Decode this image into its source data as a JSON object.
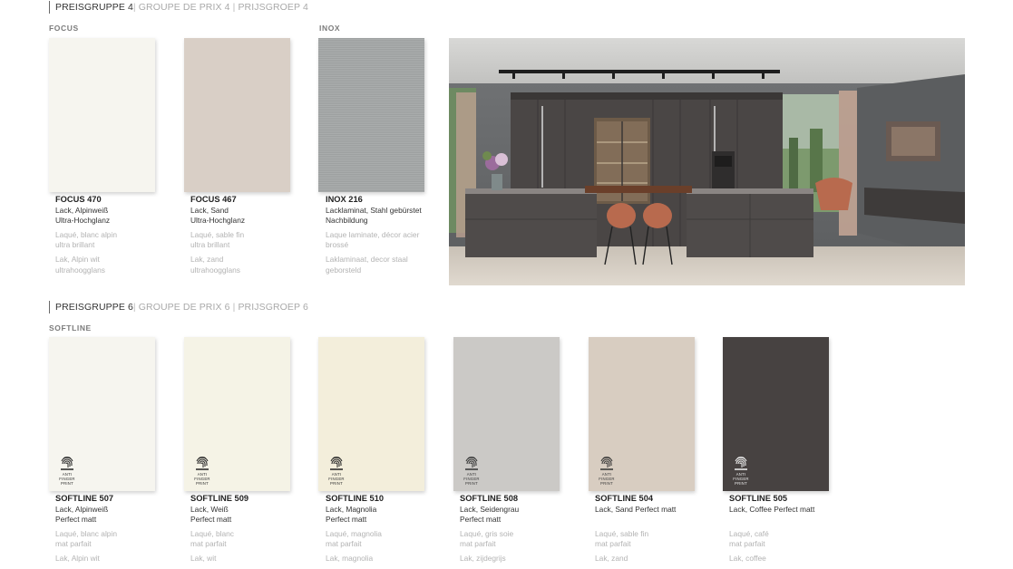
{
  "groups": [
    {
      "title_main": "PREISGRUPPE 4",
      "title_fr": "GROUPE DE PRIX 4",
      "title_nl": "PRIJSGROEP 4"
    },
    {
      "title_main": "PREISGRUPPE 6",
      "title_fr": "GROUPE DE PRIX 6",
      "title_nl": "PRIJSGROEP 6"
    }
  ],
  "lines": {
    "focus": "FOCUS",
    "inox": "INOX",
    "softline": "SOFTLINE"
  },
  "colors": {
    "focus_470": "#f6f5ef",
    "focus_467": "#d9cfc6",
    "inox_216": "#a3a6a6",
    "softline_507": "#f6f5ef",
    "softline_509": "#f5f3e6",
    "softline_510": "#f3eedb",
    "softline_508": "#cbc9c6",
    "softline_504": "#d8cdc1",
    "softline_505": "#474241"
  },
  "anti_fingerprint": {
    "line1": "ANTI",
    "line2": "FINGER",
    "line3": "PRINT",
    "icon": "fingerprint-icon"
  },
  "products": [
    {
      "name": "FOCUS 470",
      "de1": "Lack, Alpinweiß",
      "de2": "Ultra-Hochglanz",
      "fr1": "Laqué, blanc alpin",
      "fr2": "ultra brillant",
      "nl1": "Lak, Alpin wit",
      "nl2": "ultrahoogglans"
    },
    {
      "name": "FOCUS 467",
      "de1": "Lack, Sand",
      "de2": "Ultra-Hochglanz",
      "fr1": "Laqué, sable fin",
      "fr2": "ultra brillant",
      "nl1": "Lak, zand",
      "nl2": "ultrahoogglans"
    },
    {
      "name": "INOX 216",
      "de1": "Lacklaminat, Stahl gebürstet",
      "de2": "Nachbildung",
      "fr1": "Laque laminate, décor acier",
      "fr2": "brossé",
      "nl1": "Laklaminaat, decor staal",
      "nl2": "geborsteld"
    },
    {
      "name": "SOFTLINE 507",
      "de1": "Lack, Alpinweiß",
      "de2": "Perfect matt",
      "fr1": "Laqué, blanc alpin",
      "fr2": "mat parfait",
      "nl1": "Lak, Alpin wit"
    },
    {
      "name": "SOFTLINE 509",
      "de1": "Lack, Weiß",
      "de2": "Perfect matt",
      "fr1": "Laqué, blanc",
      "fr2": "mat parfait",
      "nl1": "Lak, wit"
    },
    {
      "name": "SOFTLINE 510",
      "de1": "Lack, Magnolia",
      "de2": "Perfect matt",
      "fr1": "Laqué, magnolia",
      "fr2": "mat parfait",
      "nl1": "Lak, magnolia"
    },
    {
      "name": "SOFTLINE 508",
      "de1": "Lack, Seidengrau",
      "de2": "Perfect matt",
      "fr1": "Laqué, gris soie",
      "fr2": "mat parfait",
      "nl1": "Lak, zijdegrijs"
    },
    {
      "name": "SOFTLINE 504",
      "de1": "Lack, Sand Perfect matt",
      "fr1": "Laqué, sable fin",
      "fr2": "mat parfait",
      "nl1": "Lak, zand"
    },
    {
      "name": "SOFTLINE 505",
      "de1": "Lack, Coffee Perfect matt",
      "fr1": "Laqué, café",
      "fr2": "mat parfait",
      "nl1": "Lak, coffee"
    }
  ]
}
